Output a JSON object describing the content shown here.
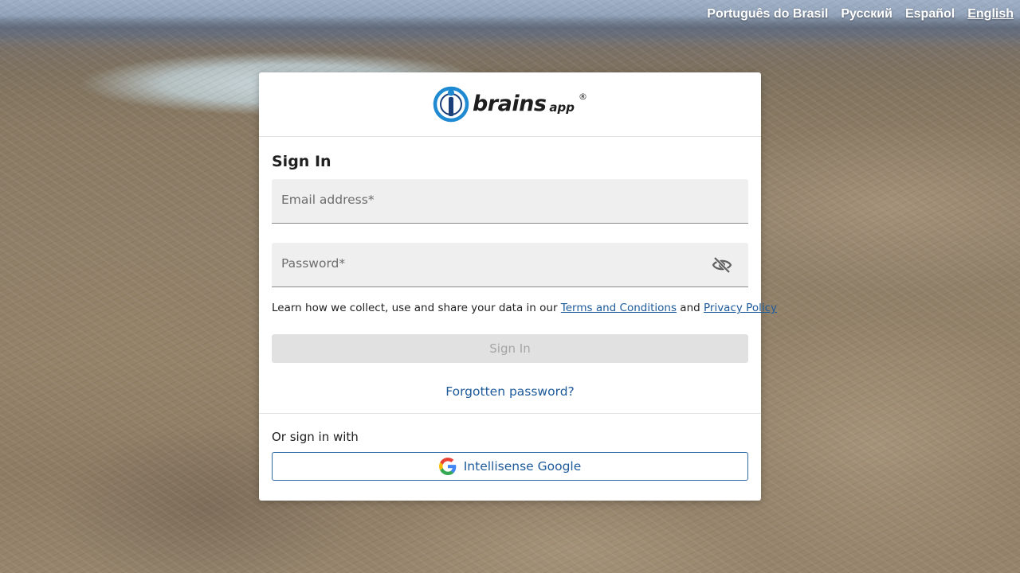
{
  "languages": [
    {
      "label": "Português do Brasil",
      "active": false
    },
    {
      "label": "Русский",
      "active": false
    },
    {
      "label": "Español",
      "active": false
    },
    {
      "label": "English",
      "active": true
    }
  ],
  "logo": {
    "word": "brains",
    "suffix": "app",
    "registered": "®"
  },
  "signin": {
    "title": "Sign In",
    "email_label": "Email address",
    "password_label": "Password",
    "required_mark": "*",
    "legal_prefix": "Learn how we collect, use and share your data in our ",
    "terms_link": "Terms and Conditions",
    "legal_and": " and ",
    "privacy_link": "Privacy Policy",
    "submit_label": "Sign In",
    "forgot_label": "Forgotten password?"
  },
  "alt_signin": {
    "label": "Or sign in with",
    "google_label": "Intellisense Google"
  },
  "icons": {
    "password_toggle": "eye-off-icon",
    "google": "google-icon"
  },
  "colors": {
    "link": "#1d5a9a",
    "disabled_bg": "#e1e1e1",
    "logo_blue": "#1f8ad1"
  }
}
